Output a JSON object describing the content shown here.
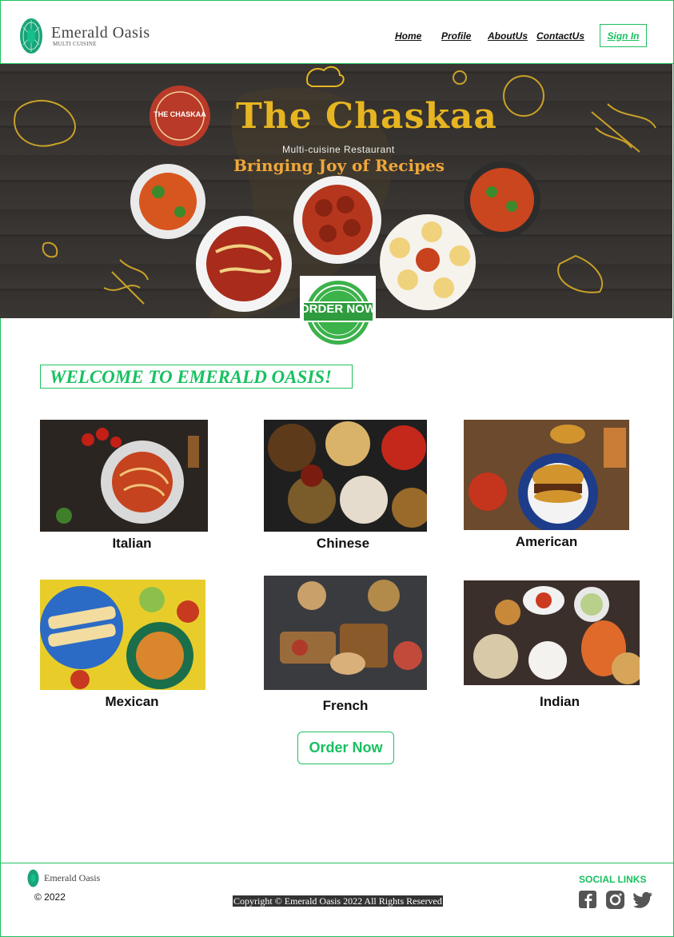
{
  "brand": {
    "name": "Emerald Oasis",
    "tagline": "MULTI CUISINE"
  },
  "nav": {
    "items": [
      {
        "label": "Home"
      },
      {
        "label": "Profile"
      },
      {
        "label": "AboutUs"
      },
      {
        "label": "ContactUs"
      }
    ],
    "signin_label": "Sign In"
  },
  "banner": {
    "title": "The Chaskaa",
    "subtitle": "Multi-cuisine Restaurant",
    "tagline": "Bringing Joy of Recipes",
    "badge_text": "THE CHASKAA",
    "stamp_label": "ORDER NOW"
  },
  "welcome_heading": "WELCOME TO EMERALD OASIS!",
  "cuisines": [
    {
      "label": "Italian"
    },
    {
      "label": "Chinese"
    },
    {
      "label": "American"
    },
    {
      "label": "Mexican"
    },
    {
      "label": "French"
    },
    {
      "label": "Indian"
    }
  ],
  "order_button_label": "Order Now",
  "footer": {
    "brand": "Emerald Oasis",
    "copyright_symbol_year": "©  2022",
    "copyright": "Copyright © Emerald Oasis 2022 All Rights Reserved",
    "social_title": "SOCIAL LINKS",
    "social": [
      "facebook-icon",
      "instagram-icon",
      "twitter-icon"
    ]
  },
  "colors": {
    "accent": "#18c060",
    "banner_gold": "#e7b522",
    "banner_orange": "#f0a73a",
    "wood": "#35312f"
  }
}
